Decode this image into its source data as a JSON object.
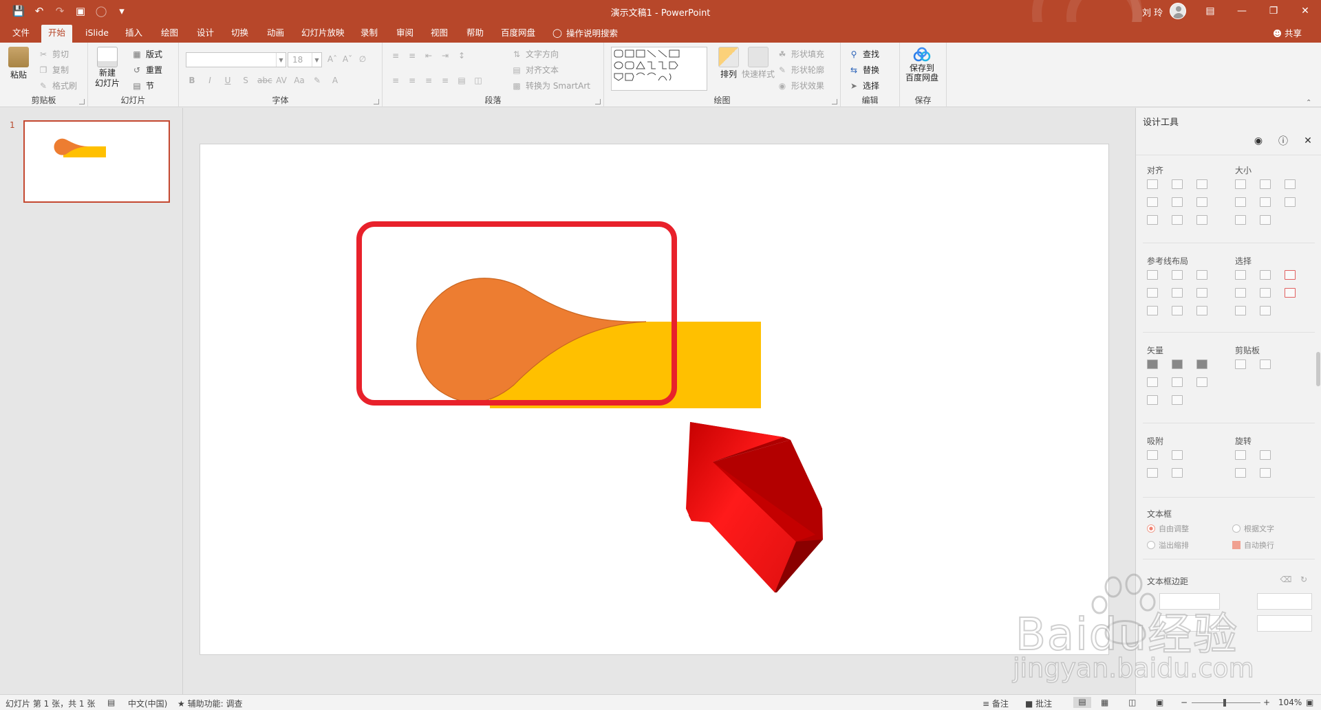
{
  "titlebar": {
    "doc_title": "演示文稿1 - PowerPoint",
    "user_name": "刘 玲"
  },
  "tabs": [
    "文件",
    "开始",
    "iSlide",
    "插入",
    "绘图",
    "设计",
    "切换",
    "动画",
    "幻灯片放映",
    "录制",
    "审阅",
    "视图",
    "帮助",
    "百度网盘"
  ],
  "active_tab": "开始",
  "tell_me": "操作说明搜索",
  "share": "共享",
  "ribbon": {
    "clipboard": {
      "label": "剪贴板",
      "paste": "粘贴",
      "cut": "剪切",
      "copy": "复制",
      "format_painter": "格式刷"
    },
    "slides": {
      "label": "幻灯片",
      "new_slide_1": "新建",
      "new_slide_2": "幻灯片",
      "layout": "版式",
      "reset": "重置",
      "section": "节"
    },
    "font": {
      "label": "字体",
      "size": "18"
    },
    "paragraph": {
      "label": "段落",
      "text_direction": "文字方向",
      "align_text": "对齐文本",
      "smartart": "转换为 SmartArt"
    },
    "drawing": {
      "label": "绘图",
      "arrange": "排列",
      "quick_styles": "快速样式",
      "shape_fill": "形状填充",
      "shape_outline": "形状轮廓",
      "shape_effects": "形状效果"
    },
    "editing": {
      "label": "编辑",
      "find": "查找",
      "replace": "替换",
      "select": "选择"
    },
    "save": {
      "label": "保存",
      "save_to_1": "保存到",
      "save_to_2": "百度网盘"
    }
  },
  "thumbnails": [
    {
      "number": "1"
    }
  ],
  "design_pane": {
    "title": "设计工具",
    "sections": {
      "align": "对齐",
      "size": "大小",
      "guides": "参考线布局",
      "select": "选择",
      "vector": "矢量",
      "clipboard": "剪贴板",
      "snap": "吸附",
      "rotate": "旋转",
      "textbox": "文本框",
      "textbox_margin": "文本框边距"
    },
    "textbox_options": {
      "auto_fit": "自由调整",
      "by_text": "根据文字",
      "overflow_shrink": "溢出缩排",
      "auto_wrap": "自动换行"
    }
  },
  "statusbar": {
    "slide_info": "幻灯片 第 1 张，共 1 张",
    "language": "中文(中国)",
    "accessibility": "辅助功能: 调查",
    "notes": "备注",
    "comments": "批注",
    "zoom": "104%"
  },
  "watermark": {
    "brand": "Baidu经验",
    "url": "jingyan.baidu.com"
  },
  "colors": {
    "accent": "#b7472a",
    "orange_shape": "#ed7d31",
    "yellow_shape": "#ffc000",
    "highlight_box": "#e8212b",
    "arrow_red": "#e01010"
  }
}
